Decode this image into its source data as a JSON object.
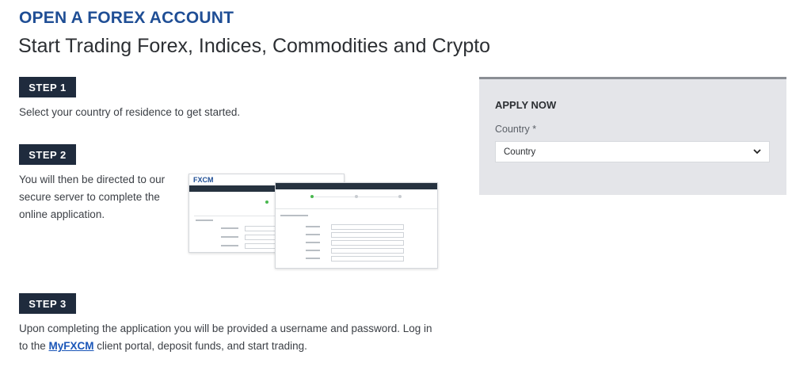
{
  "header": {
    "kicker": "OPEN A FOREX ACCOUNT",
    "headline": "Start Trading Forex, Indices, Commodities and Crypto"
  },
  "steps": [
    {
      "badge": "STEP 1",
      "text": "Select your country of residence to get started."
    },
    {
      "badge": "STEP 2",
      "text_lines": [
        "You will then be directed to our",
        "secure server to complete the",
        "online application."
      ]
    },
    {
      "badge": "STEP 3",
      "text_line1": "Upon completing the application you will be provided a username and password. Log in",
      "text_pre": "to the ",
      "link": "MyFXCM",
      "text_post": " client portal, deposit funds, and start trading."
    }
  ],
  "illustration": {
    "logo": "FXCM"
  },
  "apply": {
    "title": "APPLY NOW",
    "country_label": "Country *",
    "country_value": "Country",
    "chevron_icon": "chevron-down-icon"
  },
  "colors": {
    "brand_blue": "#1f4e95",
    "badge_bg": "#1f2b3d",
    "panel_bg": "#e4e5e9"
  }
}
